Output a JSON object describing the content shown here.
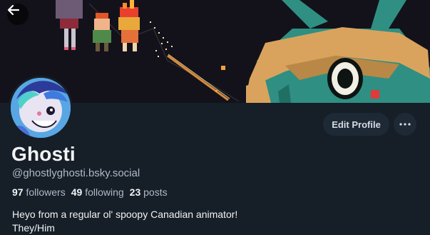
{
  "header": {
    "back_icon": "arrow-left-icon",
    "banner_alt": "pixel art banner"
  },
  "profile": {
    "display_name": "Ghosti",
    "handle": "@ghostlyghosti.bsky.social",
    "followers_count": "97",
    "followers_label": "followers",
    "following_count": "49",
    "following_label": "following",
    "posts_count": "23",
    "posts_label": "posts",
    "bio_line1": "Heyo from a regular ol' spoopy Canadian animator!",
    "bio_line2": "They/Him"
  },
  "actions": {
    "edit_profile_label": "Edit Profile",
    "more_icon": "ellipsis-icon"
  },
  "colors": {
    "background": "#161e27",
    "button_bg": "#1e2936",
    "muted_text": "#aebbc9",
    "banner_bg": "#13121a"
  }
}
